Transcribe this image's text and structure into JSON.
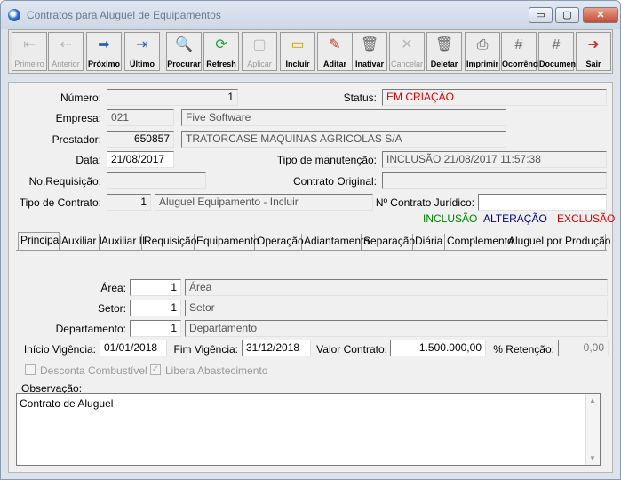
{
  "window": {
    "title": "Contratos para Aluguel de Equipamentos",
    "min_icon": "▭",
    "max_icon": "▢",
    "close_icon": "✕"
  },
  "toolbar": [
    {
      "label": "Primeiro",
      "icon": "first-icon",
      "enabled": false
    },
    {
      "label": "Anterior",
      "icon": "previous-icon",
      "enabled": false
    },
    {
      "label": "Próximo",
      "icon": "next-icon",
      "enabled": true
    },
    {
      "label": "Último",
      "icon": "last-icon",
      "enabled": true
    },
    {
      "label": "Procurar",
      "icon": "search-icon",
      "enabled": true
    },
    {
      "label": "Refresh",
      "icon": "refresh-icon",
      "enabled": true
    },
    {
      "label": "Aplicar",
      "icon": "apply-icon",
      "enabled": false
    },
    {
      "label": "Incluir",
      "icon": "new-icon",
      "enabled": true
    },
    {
      "label": "Aditar",
      "icon": "edit-icon",
      "enabled": true
    },
    {
      "label": "Inativar",
      "icon": "inactivate-icon",
      "enabled": true
    },
    {
      "label": "Cancelar",
      "icon": "cancel-icon",
      "enabled": false
    },
    {
      "label": "Deletar",
      "icon": "delete-icon",
      "enabled": true
    },
    {
      "label": "Imprimir",
      "icon": "print-icon",
      "enabled": true
    },
    {
      "label": "Ocorrência",
      "icon": "occurrence-icon",
      "enabled": true
    },
    {
      "label": "Documento",
      "icon": "document-icon",
      "enabled": true
    },
    {
      "label": "Sair",
      "icon": "exit-icon",
      "enabled": true
    }
  ],
  "header": {
    "numero_label": "Número:",
    "numero": "1",
    "status_label": "Status:",
    "status": "EM CRIAÇÃO",
    "empresa_label": "Empresa:",
    "empresa_code": "021",
    "empresa_name": "Five Software",
    "prestador_label": "Prestador:",
    "prestador_code": "650857",
    "prestador_name": "TRATORCASE MAQUINAS AGRICOLAS S/A",
    "data_label": "Data:",
    "data": "21/08/2017",
    "tipo_manut_label": "Tipo de manutenção:",
    "tipo_manut": "INCLUSÃO 21/08/2017 11:57:38",
    "requisicao_label": "No.Requisição:",
    "requisicao": "",
    "contrato_orig_label": "Contrato Original:",
    "contrato_orig": "",
    "tipo_contrato_label": "Tipo de Contrato:",
    "tipo_contrato_code": "1",
    "tipo_contrato_name": "Aluguel Equipamento - Incluir",
    "contrato_jur_label": "Nº Contrato Jurídico:",
    "contrato_jur": ""
  },
  "legend": {
    "inclusao": "INCLUSÃO",
    "alteracao": "ALTERAÇÃO",
    "exclusao": "EXCLUSÃO",
    "colors": {
      "inclusao": "#008000",
      "alteracao": "#00008b",
      "exclusao": "#e00000"
    }
  },
  "tabs": [
    "Principal",
    "Auxiliar I",
    "Auxiliar II",
    "Requisição",
    "Equipamento",
    "Operação",
    "Adiantamento",
    "Separação",
    "Diária",
    "Complemento",
    "Aluguel por Produção"
  ],
  "principal": {
    "area_label": "Área:",
    "area_code": "1",
    "area_name": "Área",
    "setor_label": "Setor:",
    "setor_code": "1",
    "setor_name": "Setor",
    "depto_label": "Departamento:",
    "depto_code": "1",
    "depto_name": "Departamento",
    "inicio_label": "Início Vigência:",
    "inicio": "01/01/2018",
    "fim_label": "Fim Vigência:",
    "fim": "31/12/2018",
    "valor_label": "Valor Contrato:",
    "valor": "1.500.000,00",
    "retencao_label": "% Retenção:",
    "retencao": "0,00",
    "desconta_label": "Desconta Combustível",
    "desconta_checked": false,
    "libera_label": "Libera Abastecimento",
    "libera_checked": true,
    "obs_label": "Observação:",
    "obs": "Contrato de Aluguel"
  }
}
